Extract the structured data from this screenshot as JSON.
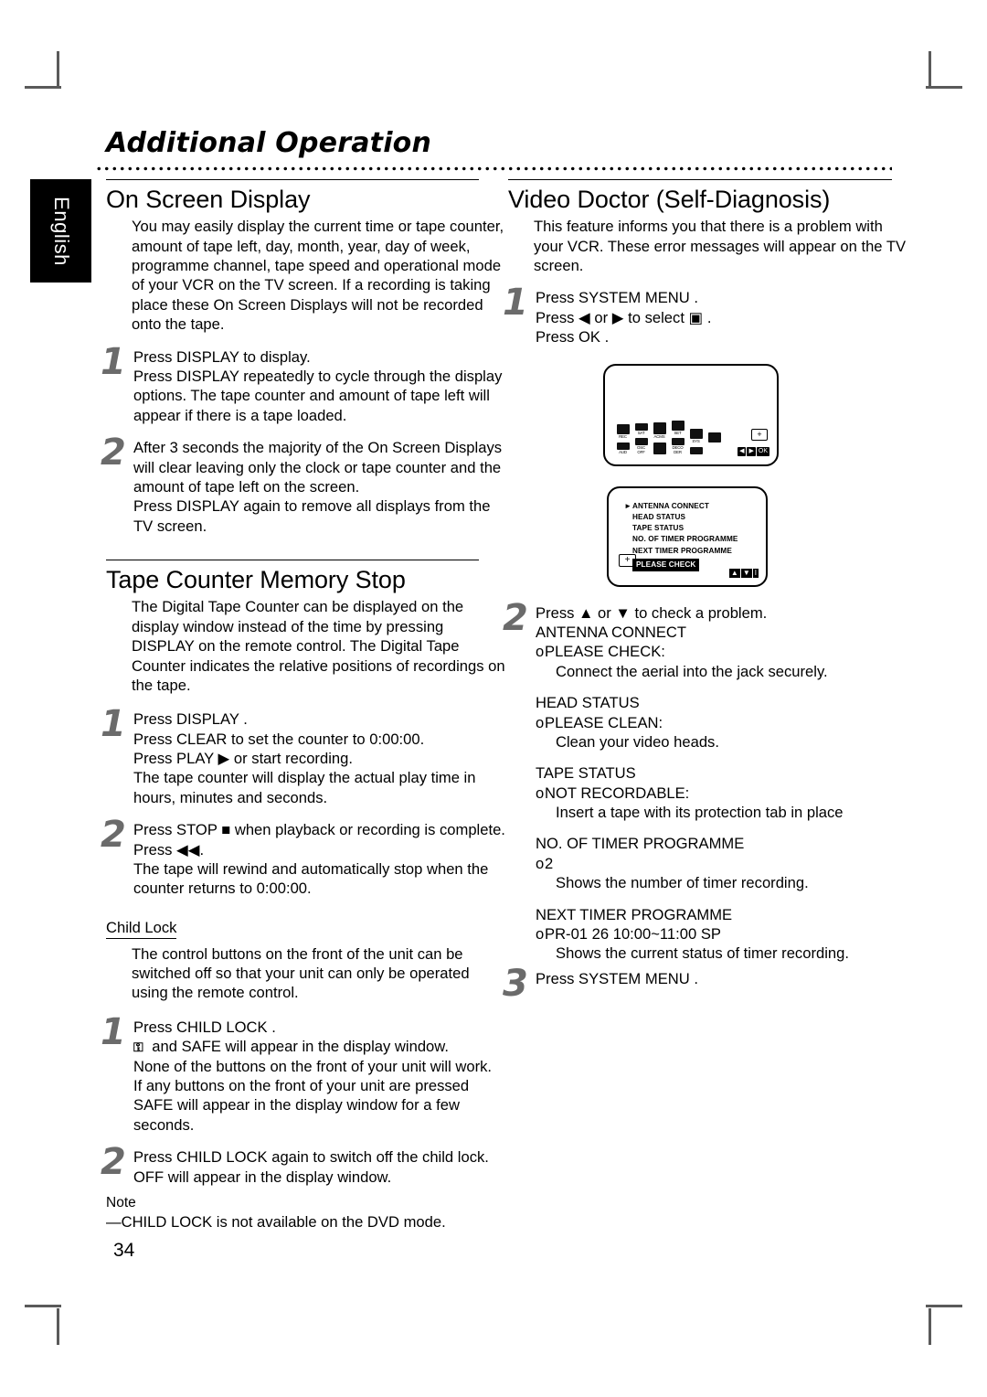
{
  "page": {
    "title": "Additional Operation",
    "number": "34",
    "language_tab": "English"
  },
  "left_column": {
    "on_screen_display": {
      "heading": "On Screen Display",
      "intro": "You may easily display the current time or tape counter, amount of tape left, day, month, year, day of week, programme channel, tape speed and operational mode of your VCR on the TV screen. If a recording is taking place these On Screen Displays will not be recorded onto the tape.",
      "steps": [
        {
          "num": "1",
          "lines": [
            "Press DISPLAY  to display.",
            "Press DISPLAY  repeatedly to cycle through the display options. The tape counter and amount of tape left will appear if there is a tape loaded."
          ]
        },
        {
          "num": "2",
          "lines": [
            "After 3 seconds the majority of the On Screen Displays will clear leaving only the clock or tape counter and the amount of tape left on the screen.",
            "Press DISPLAY  again to remove all displays from the TV screen."
          ]
        }
      ]
    },
    "tape_counter_memory_stop": {
      "heading": "Tape Counter Memory Stop",
      "intro": "The Digital Tape Counter  can be displayed on the display window instead of the time by pressing DISPLAY on the remote control. The Digital Tape Counter indicates the relative positions of recordings on the tape.",
      "steps": [
        {
          "num": "1",
          "lines": [
            "Press DISPLAY .",
            "Press CLEAR  to set the counter to 0:00:00.",
            "Press PLAY ▶ or start recording.",
            "The tape counter will display the actual play time in hours, minutes and seconds."
          ]
        },
        {
          "num": "2",
          "lines": [
            "Press STOP ■ when playback or recording is complete.",
            "Press ◀◀.",
            "The tape will rewind and automatically stop when the counter returns to 0:00:00."
          ]
        }
      ]
    },
    "child_lock": {
      "heading": "Child Lock",
      "intro": "The control buttons on the front of the unit can be switched off so that your unit can only be operated using the remote control.",
      "steps": [
        {
          "num": "1",
          "lines": [
            "Press CHILD LOCK  .",
            "KEYICON and SAFE will appear in the display window.",
            "None of the  buttons on the front of your unit will work.",
            "If any buttons on the front of your unit are pressed SAFE will appear in the display window for a few seconds."
          ]
        },
        {
          "num": "2",
          "lines": [
            "Press CHILD LOCK   again to switch off the child lock.",
            "OFF will appear in the display window."
          ]
        }
      ],
      "note_label": "Note",
      "note_text": "—CHILD LOCK  is not available on the DVD mode."
    }
  },
  "right_column": {
    "video_doctor": {
      "heading": "Video Doctor (Self-Diagnosis)",
      "intro": "This feature informs you that there is a problem with your VCR. These error messages will appear on the TV screen.",
      "step1": {
        "num": "1",
        "lines": [
          "Press SYSTEM MENU .",
          "Press ◀ or ▶ to select ▣ .",
          "Press OK ."
        ]
      },
      "step2": {
        "num": "2",
        "intro": "Press ▲ or ▼ to check a problem.",
        "items": [
          {
            "title": "ANTENNA CONNECT",
            "value": "PLEASE CHECK:",
            "desc": "Connect the aerial into the jack securely."
          },
          {
            "title": "HEAD STATUS",
            "value": "PLEASE CLEAN:",
            "desc": "Clean your video heads."
          },
          {
            "title": "TAPE STATUS",
            "value": "NOT RECORDABLE:",
            "desc": "Insert a tape with its protection tab in place"
          },
          {
            "title": "NO. OF TIMER PROGRAMME",
            "value": "2",
            "desc": "Shows the number of timer recording."
          },
          {
            "title": "NEXT TIMER PROGRAMME",
            "value": "PR-01 26 10:00~11:00 SP",
            "desc": "Shows the current status of timer recording."
          }
        ]
      },
      "step3": {
        "num": "3",
        "lines": [
          "Press SYSTEM MENU ."
        ]
      }
    },
    "tv_menu_screen": {
      "icons": [
        {
          "cap": "REC"
        },
        {
          "cap": "SAT"
        },
        {
          "cap": "ACMS"
        },
        {
          "cap": "SET"
        },
        {
          "cap": "SYS"
        }
      ],
      "icons_row2": [
        {
          "cap": "AUD"
        },
        {
          "cap": "OSC\nOFF"
        },
        {
          "cap": ""
        },
        {
          "cap": "DECO\nDER"
        }
      ],
      "plus_badge": "+",
      "nav_left": "◀",
      "nav_right": "▶",
      "nav_ok": "OK"
    },
    "tv_diagnosis_screen": {
      "arrow": "►",
      "rows": [
        "ANTENNA CONNECT",
        "HEAD STATUS",
        "TAPE STATUS",
        "NO. OF TIMER PROGRAMME",
        "NEXT TIMER PROGRAMME"
      ],
      "highlight": "PLEASE CHECK",
      "plus_badge": "+",
      "nav_up": "▲",
      "nav_down": "▼",
      "nav_bar": "I"
    }
  }
}
